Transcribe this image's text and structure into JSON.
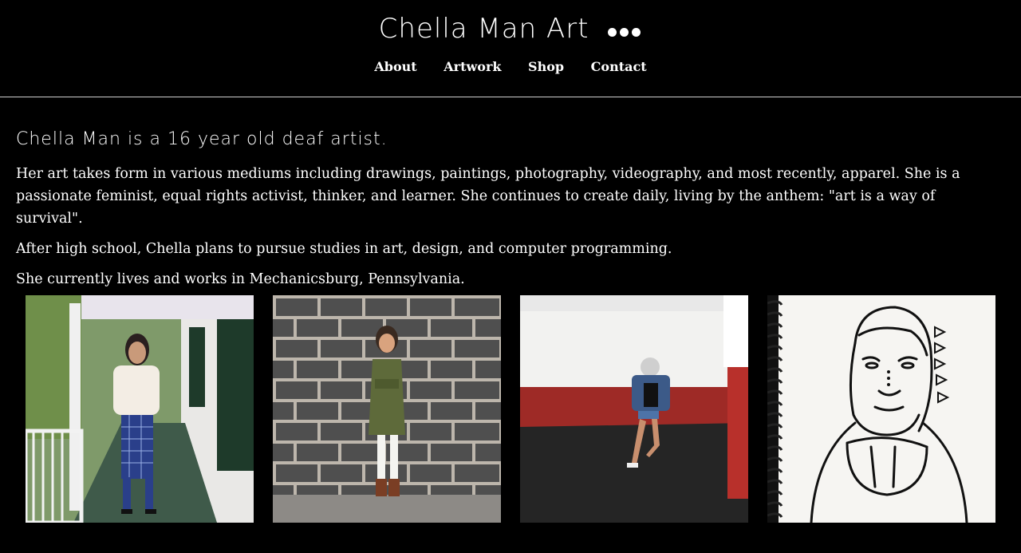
{
  "header": {
    "site_title": "Chella Man Art",
    "nav": [
      "About",
      "Artwork",
      "Shop",
      "Contact"
    ]
  },
  "main": {
    "tagline": "Chella Man is a 16 year old deaf artist.",
    "paragraphs": [
      "Her art takes form in various mediums including drawings, paintings, photography, videography, and most recently, apparel. She is a passionate feminist, equal rights activist, thinker, and learner. She continues to create daily, living by the anthem: \"art is a way of survival\".",
      "After high school, Chella plans to pursue studies in art, design, and computer programming.",
      "She currently lives and works in Mechanicsburg, Pennsylvania."
    ]
  },
  "gallery": {
    "images": [
      "photo-porch-portrait",
      "photo-cinderblock-wall",
      "photo-red-wall",
      "sketchbook-drawing"
    ]
  },
  "colors": {
    "background": "#000000",
    "text": "#ffffff",
    "divider": "#cfcfcf"
  }
}
